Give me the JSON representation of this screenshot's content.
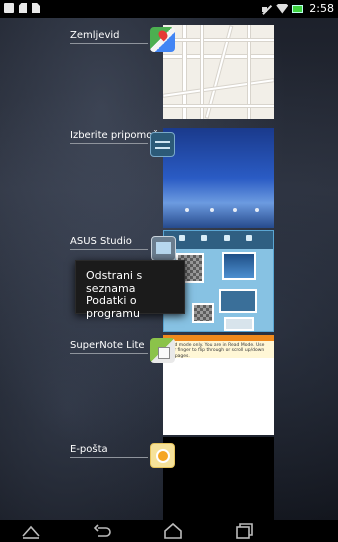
{
  "status_bar": {
    "left_icons": [
      "image-icon",
      "sd-card-icon",
      "document-icon"
    ],
    "right_icons": [
      "mute-icon",
      "wifi-icon",
      "battery-icon"
    ],
    "time": "2:58"
  },
  "recent_apps": [
    {
      "label": "Zemljevid",
      "icon": "maps-icon"
    },
    {
      "label": "Izberite pripomoček",
      "icon": "widget-picker-icon"
    },
    {
      "label": "ASUS Studio",
      "icon": "asus-studio-icon"
    },
    {
      "label": "SuperNote Lite",
      "icon": "supernote-icon"
    },
    {
      "label": "E-pošta",
      "icon": "email-icon"
    }
  ],
  "context_menu": {
    "items": [
      "Odstrani s seznama",
      "Podatki o programu"
    ]
  },
  "supernote_thumb": {
    "note": "Read mode only. You are in Read Mode. Use your finger to flip through or scroll up/down the pages."
  },
  "navigation_bar": {
    "buttons": [
      "menu-icon",
      "back-icon",
      "home-icon",
      "recent-apps-icon"
    ]
  },
  "colors": {
    "accent_orange": "#f08a1c",
    "studio_blue": "#87c2e3",
    "battery_green": "#3fd13f"
  }
}
